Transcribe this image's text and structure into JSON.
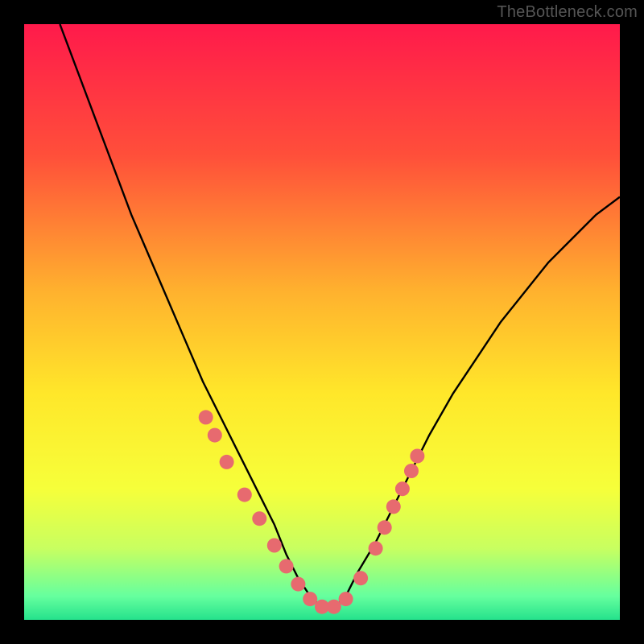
{
  "watermark": "TheBottleneck.com",
  "chart_data": {
    "type": "line",
    "title": "",
    "xlabel": "",
    "ylabel": "",
    "xlim": [
      0,
      100
    ],
    "ylim": [
      0,
      100
    ],
    "grid": false,
    "legend": false,
    "background_gradient_stops": [
      {
        "offset": 0.0,
        "color": "#ff1a4b"
      },
      {
        "offset": 0.22,
        "color": "#ff4f3a"
      },
      {
        "offset": 0.45,
        "color": "#ffb22e"
      },
      {
        "offset": 0.62,
        "color": "#ffe72a"
      },
      {
        "offset": 0.78,
        "color": "#f6ff3a"
      },
      {
        "offset": 0.88,
        "color": "#c8ff60"
      },
      {
        "offset": 0.96,
        "color": "#66ff9e"
      },
      {
        "offset": 1.0,
        "color": "#25e28c"
      }
    ],
    "series": [
      {
        "name": "bottleneck_curve",
        "x": [
          6,
          9,
          12,
          15,
          18,
          21,
          24,
          27,
          30,
          33,
          36,
          39,
          42,
          44,
          46,
          48,
          50,
          52,
          54,
          56,
          59,
          62,
          65,
          68,
          72,
          76,
          80,
          84,
          88,
          92,
          96,
          100
        ],
        "y": [
          100,
          92,
          84,
          76,
          68,
          61,
          54,
          47,
          40,
          34,
          28,
          22,
          16,
          11,
          7,
          4,
          2,
          2,
          4,
          8,
          13,
          19,
          25,
          31,
          38,
          44,
          50,
          55,
          60,
          64,
          68,
          71
        ]
      }
    ],
    "markers": {
      "name": "highlight_dots",
      "color": "#e76a6f",
      "radius": 9,
      "x": [
        30.5,
        32.0,
        34.0,
        37.0,
        39.5,
        42.0,
        44.0,
        46.0,
        48.0,
        50.0,
        52.0,
        54.0,
        56.5,
        59.0,
        60.5,
        62.0,
        63.5,
        65.0,
        66.0
      ],
      "y": [
        34.0,
        31.0,
        26.5,
        21.0,
        17.0,
        12.5,
        9.0,
        6.0,
        3.5,
        2.2,
        2.2,
        3.5,
        7.0,
        12.0,
        15.5,
        19.0,
        22.0,
        25.0,
        27.5
      ]
    }
  }
}
